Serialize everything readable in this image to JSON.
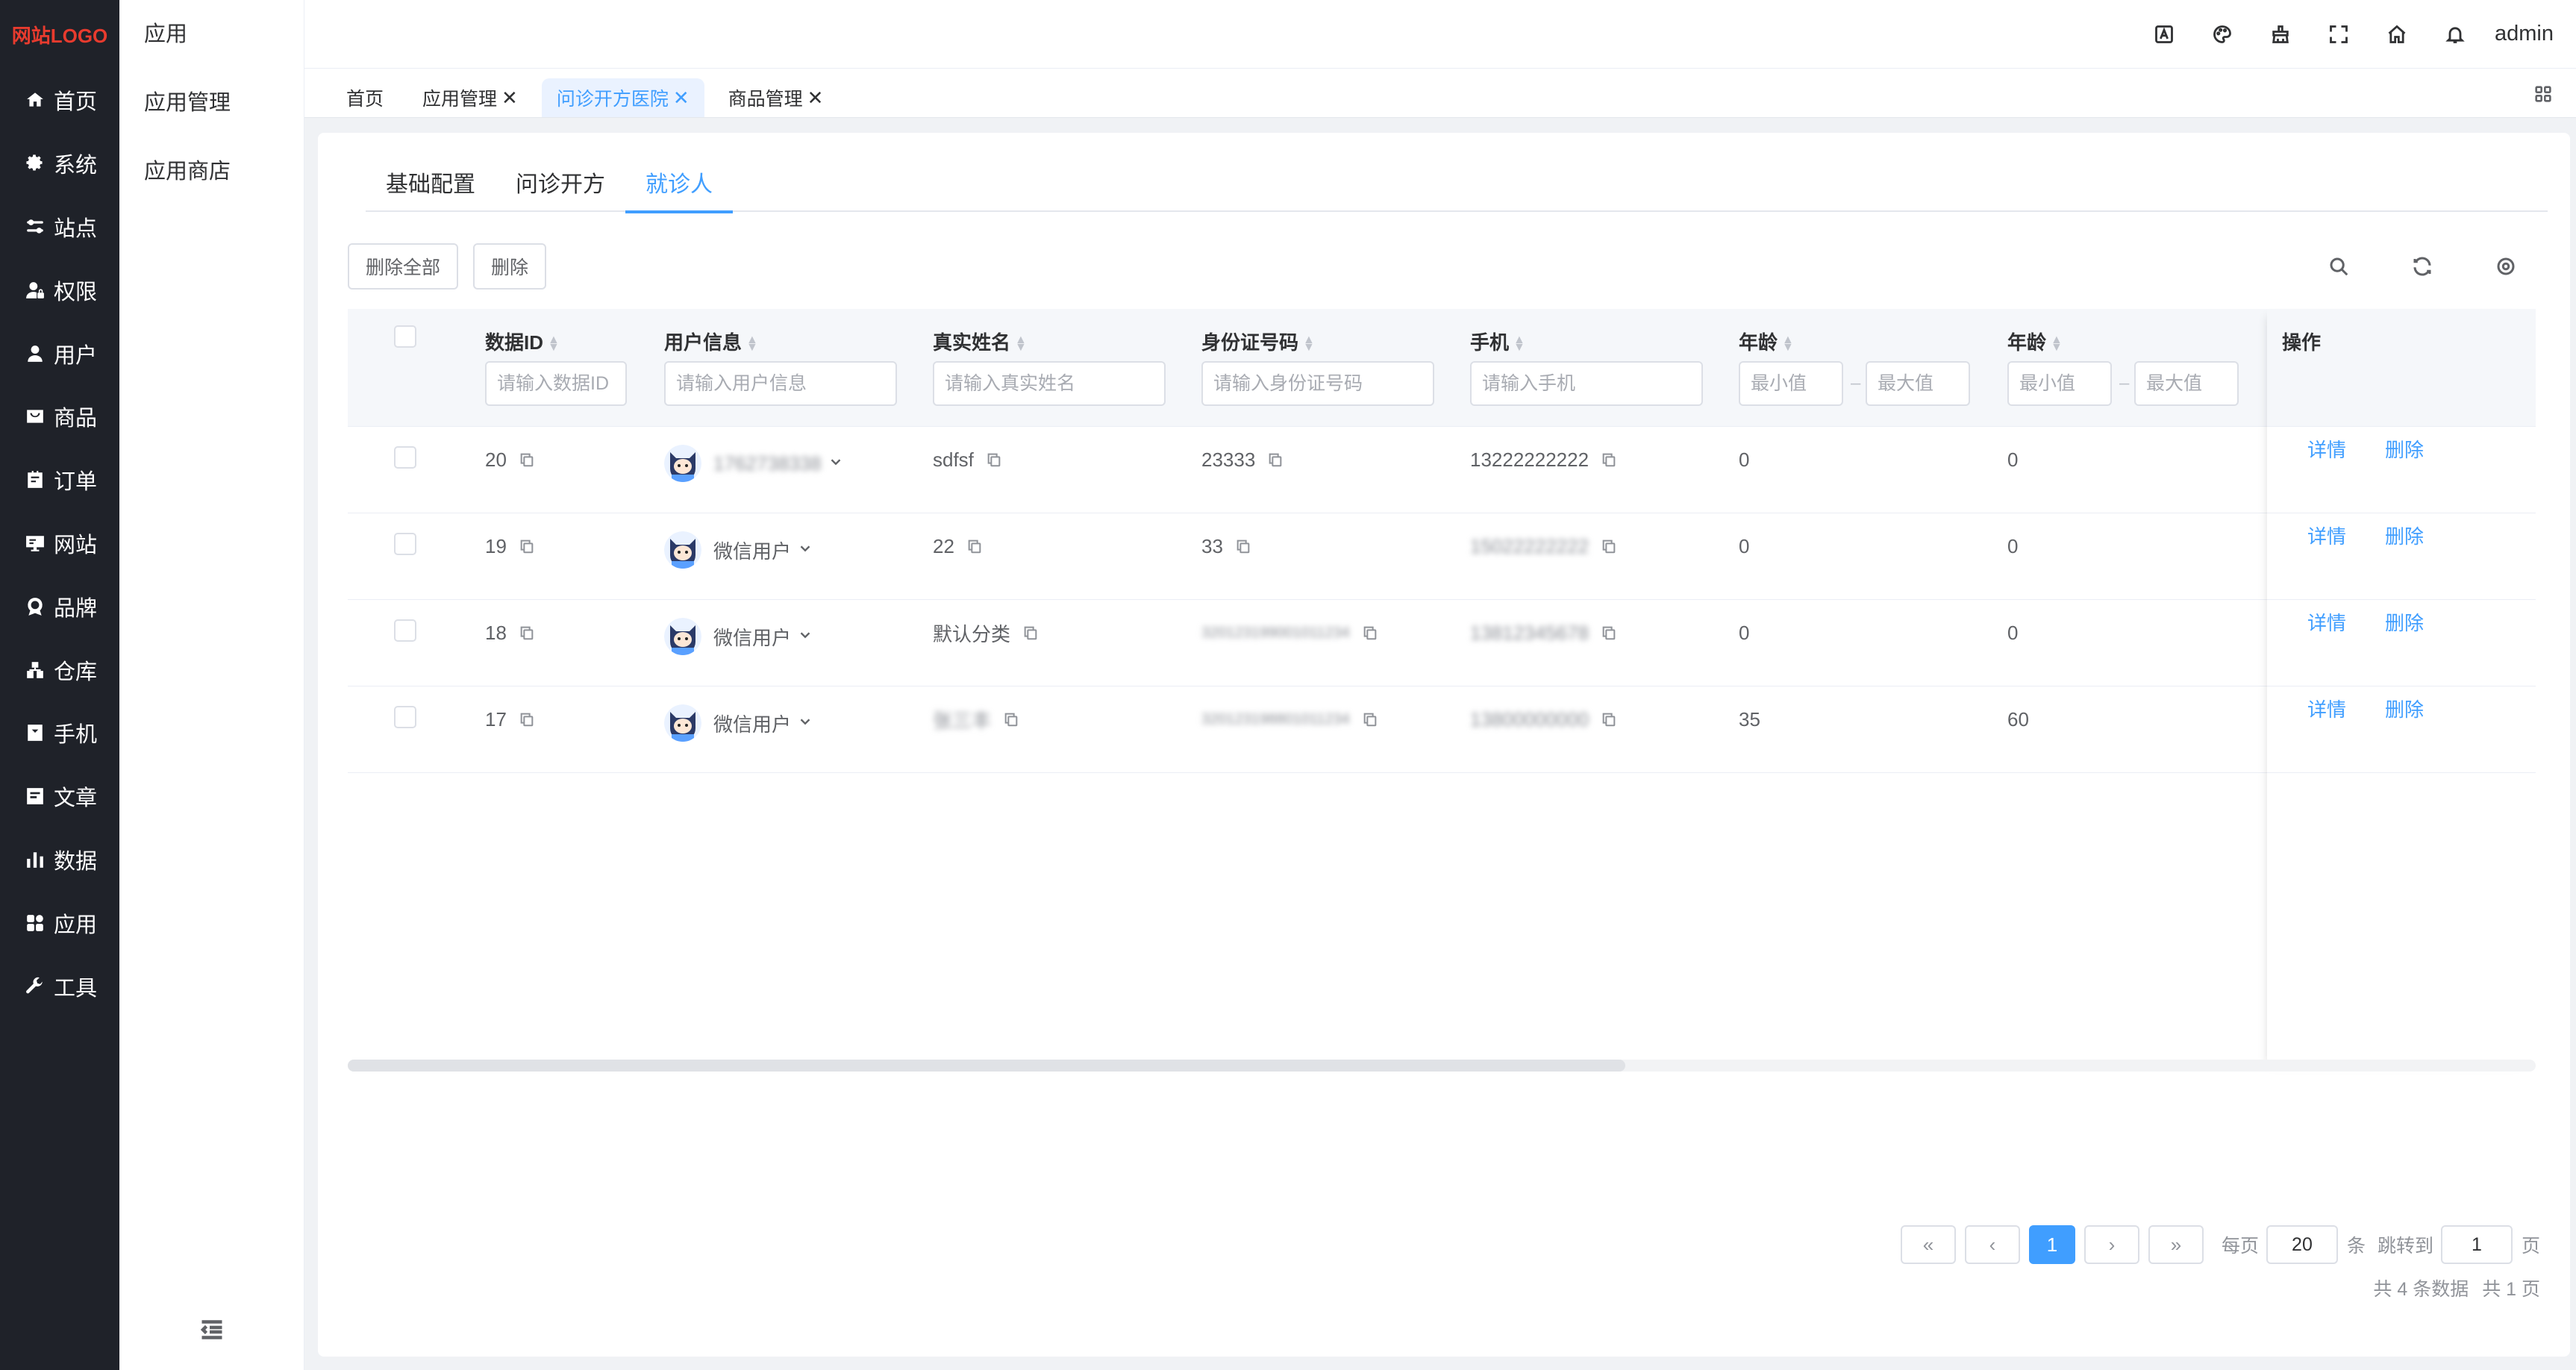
{
  "logo": "网站LOGO",
  "sidebar": {
    "items": [
      {
        "label": "首页",
        "icon": "home-icon"
      },
      {
        "label": "系统",
        "icon": "gear-icon"
      },
      {
        "label": "站点",
        "icon": "sliders-icon"
      },
      {
        "label": "权限",
        "icon": "user-lock-icon"
      },
      {
        "label": "用户",
        "icon": "user-icon"
      },
      {
        "label": "商品",
        "icon": "bag-icon"
      },
      {
        "label": "订单",
        "icon": "order-icon"
      },
      {
        "label": "网站",
        "icon": "monitor-icon"
      },
      {
        "label": "品牌",
        "icon": "brand-icon"
      },
      {
        "label": "仓库",
        "icon": "warehouse-icon"
      },
      {
        "label": "手机",
        "icon": "phone-icon"
      },
      {
        "label": "文章",
        "icon": "article-icon"
      },
      {
        "label": "数据",
        "icon": "chart-icon"
      },
      {
        "label": "应用",
        "icon": "apps-icon"
      },
      {
        "label": "工具",
        "icon": "wrench-icon"
      }
    ]
  },
  "subnav": {
    "title": "应用",
    "items": [
      "应用管理",
      "应用商店"
    ]
  },
  "header": {
    "icons": [
      "translate-icon",
      "palette-icon",
      "clear-icon",
      "fullscreen-icon",
      "home-icon",
      "bell-icon"
    ],
    "user": "admin"
  },
  "tags": [
    {
      "label": "首页",
      "closable": false
    },
    {
      "label": "应用管理",
      "closable": true
    },
    {
      "label": "问诊开方医院",
      "closable": true,
      "active": true
    },
    {
      "label": "商品管理",
      "closable": true
    }
  ],
  "tabs": [
    "基础配置",
    "问诊开方",
    "就诊人"
  ],
  "active_tab": "就诊人",
  "toolbar": {
    "delete_all": "删除全部",
    "delete": "删除"
  },
  "table": {
    "columns": {
      "id": "数据ID",
      "user": "用户信息",
      "realname": "真实姓名",
      "idcard": "身份证号码",
      "phone": "手机",
      "age1": "年龄",
      "age2": "年龄",
      "ops": "操作"
    },
    "filters": {
      "id": "请输入数据ID",
      "user": "请输入用户信息",
      "realname": "请输入真实姓名",
      "idcard": "请输入身份证号码",
      "phone": "请输入手机",
      "min": "最小值",
      "max": "最大值"
    },
    "rows": [
      {
        "id": "20",
        "user": "1762738338",
        "realname": "sdfsf",
        "idcard": "23333",
        "phone": "13222222222",
        "age1": "0",
        "age2": "0"
      },
      {
        "id": "19",
        "user": "微信用户",
        "realname": "22",
        "idcard": "33",
        "phone": "15022222222",
        "age1": "0",
        "age2": "0"
      },
      {
        "id": "18",
        "user": "微信用户",
        "realname": "默认分类",
        "idcard": "320123199001011234",
        "phone": "13812345678",
        "age1": "0",
        "age2": "0"
      },
      {
        "id": "17",
        "user": "微信用户",
        "realname": "张三丰",
        "idcard": "320123198801011234",
        "phone": "13800000000",
        "age1": "35",
        "age2": "60"
      }
    ],
    "actions": {
      "detail": "详情",
      "delete": "删除"
    }
  },
  "pagination": {
    "first": "«",
    "prev": "‹",
    "current": "1",
    "next": "›",
    "last": "»",
    "per_page_label": "每页",
    "per_page": "20",
    "per_page_unit": "条",
    "jump_label": "跳转到",
    "jump_value": "1",
    "jump_unit": "页",
    "total": "共 4 条数据",
    "pages": "共 1 页"
  },
  "colors": {
    "accent": "#409eff",
    "sidebar_bg": "#1f2229",
    "logo": "#e83b2e"
  }
}
